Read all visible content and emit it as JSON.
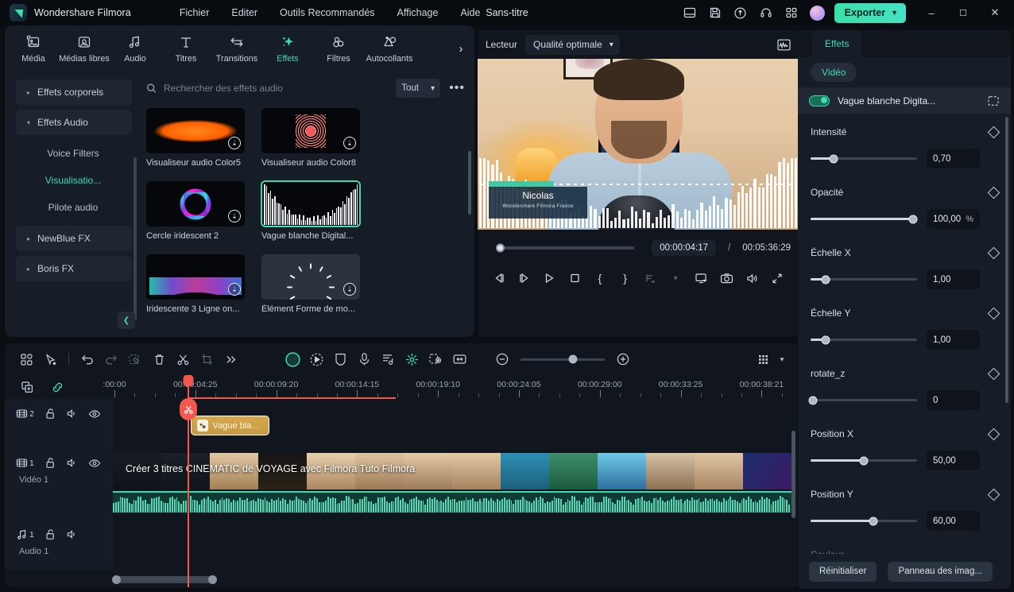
{
  "app": {
    "brand": "Wondershare Filmora",
    "document_title": "Sans-titre",
    "accent": "#3ddcb0",
    "playhead_color": "#f2584f"
  },
  "menubar": {
    "items": [
      {
        "label": "Fichier"
      },
      {
        "label": "Editer"
      },
      {
        "label": "Outils Recommandés"
      },
      {
        "label": "Affichage"
      },
      {
        "label": "Aide"
      }
    ]
  },
  "titlebar": {
    "icons": [
      {
        "name": "layout-icon"
      },
      {
        "name": "save-icon"
      },
      {
        "name": "cloud-upload-icon"
      },
      {
        "name": "headset-support-icon"
      },
      {
        "name": "apps-grid-icon"
      }
    ],
    "avatar": "user-avatar",
    "export_label": "Exporter",
    "window_buttons": {
      "minimize": "–",
      "maximize": "☐",
      "close": "✕"
    }
  },
  "ribbon": {
    "tabs": [
      {
        "label": "Média",
        "icon": "media-icon",
        "active": false
      },
      {
        "label": "Médias libres",
        "icon": "stock-media-icon",
        "active": false
      },
      {
        "label": "Audio",
        "icon": "audio-note-icon",
        "active": false
      },
      {
        "label": "Titres",
        "icon": "titles-icon",
        "active": false
      },
      {
        "label": "Transitions",
        "icon": "transitions-icon",
        "active": false
      },
      {
        "label": "Effets",
        "icon": "effects-sparkle-icon",
        "active": true
      },
      {
        "label": "Filtres",
        "icon": "filters-circles-icon",
        "active": false
      },
      {
        "label": "Autocollants",
        "icon": "stickers-icon",
        "active": false
      }
    ],
    "more": "›"
  },
  "browser": {
    "categories": [
      {
        "label": "Effets corporels",
        "type": "group",
        "expanded": false,
        "arrow": "▸"
      },
      {
        "label": "Effets Audio",
        "type": "group",
        "expanded": true,
        "arrow": "▾"
      },
      {
        "label": "Voice Filters",
        "type": "sub",
        "selected": false
      },
      {
        "label": "Visualisatio...",
        "type": "sub",
        "selected": true
      },
      {
        "label": "Pilote audio",
        "type": "sub",
        "selected": false
      },
      {
        "label": "NewBlue FX",
        "type": "group",
        "expanded": false,
        "arrow": "▸"
      },
      {
        "label": "Boris FX",
        "type": "group",
        "expanded": false,
        "arrow": "▸"
      }
    ],
    "collapse_icon": "chevron-left-icon",
    "search": {
      "placeholder": "Rechercher des effets audio",
      "value": "",
      "icon": "search-icon"
    },
    "filter": {
      "label": "Tout",
      "chevron": "⌄"
    },
    "more_options": "•••",
    "effects": [
      {
        "name": "Visualiseur audio Color5",
        "art": "lens",
        "downloadable": true,
        "selected": false
      },
      {
        "name": "Visualiseur audio Color8",
        "art": "rose",
        "downloadable": true,
        "selected": false
      },
      {
        "name": "Cercle iridescent 2",
        "art": "circle",
        "downloadable": true,
        "selected": false
      },
      {
        "name": "Vague blanche Digital...",
        "art": "bars",
        "downloadable": false,
        "selected": true
      },
      {
        "name": "Iridescente 3 Ligne on...",
        "art": "line",
        "downloadable": true,
        "selected": false
      },
      {
        "name": "Élément Forme de mo...",
        "art": "spin",
        "downloadable": true,
        "selected": false
      }
    ]
  },
  "player": {
    "title": "Lecteur",
    "quality": {
      "label": "Qualité optimale",
      "chevron": "⌄"
    },
    "scope_icon": "waveform-scope-icon",
    "preview": {
      "overlay_name": "Nicolas",
      "overlay_subtitle": "Wondershare Filmora France"
    },
    "seek_position_percent": 1.3,
    "current_time": "00:00:04:17",
    "separator": "/",
    "total_time": "00:05:36:29",
    "transport": [
      {
        "name": "previous-frame-button",
        "glyph": "◁|"
      },
      {
        "name": "next-frame-button",
        "glyph": "|▷"
      },
      {
        "name": "play-button",
        "glyph": "▷"
      },
      {
        "name": "stop-button",
        "glyph": "□"
      },
      {
        "name": "mark-in-button",
        "glyph": "{"
      },
      {
        "name": "mark-out-button",
        "glyph": "}"
      },
      {
        "name": "add-marker-button",
        "glyph": "↵",
        "disabled": true
      },
      {
        "name": "marker-dropdown-button",
        "glyph": "⌄",
        "disabled": true
      }
    ],
    "transport_right": [
      {
        "name": "display-settings-button",
        "glyph": "□"
      },
      {
        "name": "snapshot-button",
        "glyph": "◎"
      },
      {
        "name": "volume-button",
        "glyph": "◁)"
      },
      {
        "name": "fullscreen-button",
        "glyph": "⤡"
      }
    ]
  },
  "properties": {
    "tab": "Effets",
    "chip": "Vidéo",
    "effect": {
      "enabled": true,
      "name": "Vague blanche Digita...",
      "mask_icon": "mask-dotted-icon"
    },
    "rows": [
      {
        "label": "Intensité",
        "value": "0,70",
        "unit": "",
        "fill_percent": 22
      },
      {
        "label": "Opacité",
        "value": "100,00",
        "unit": "%",
        "fill_percent": 96
      },
      {
        "label": "Échelle X",
        "value": "1,00",
        "unit": "",
        "fill_percent": 14
      },
      {
        "label": "Échelle Y",
        "value": "1,00",
        "unit": "",
        "fill_percent": 14
      },
      {
        "label": "rotate_z",
        "value": "0",
        "unit": "",
        "fill_percent": 2
      },
      {
        "label": "Position X",
        "value": "50,00",
        "unit": "",
        "fill_percent": 50
      },
      {
        "label": "Position Y",
        "value": "60,00",
        "unit": "",
        "fill_percent": 59
      }
    ],
    "partial_row_label": "Couleur",
    "footer": {
      "reset": "Réinitialiser",
      "keyframe_panel": "Panneau des imag..."
    }
  },
  "timeline_toolbar": {
    "left_icons": [
      {
        "name": "template-grid-icon",
        "dim": false
      },
      {
        "name": "select-tool-icon",
        "dim": false
      }
    ],
    "edit_icons": [
      {
        "name": "undo-icon",
        "dim": false
      },
      {
        "name": "redo-icon",
        "dim": true
      },
      {
        "name": "copy-effects-icon",
        "dim": true
      },
      {
        "name": "delete-icon",
        "dim": false
      },
      {
        "name": "split-scissors-icon",
        "dim": false
      },
      {
        "name": "crop-icon",
        "dim": true
      },
      {
        "name": "more-chevrons-icon",
        "dim": false
      }
    ],
    "center_icons": [
      {
        "name": "ai-mask-icon",
        "dim": false,
        "green": true
      },
      {
        "name": "motion-tracking-icon",
        "dim": false
      },
      {
        "name": "color-match-icon",
        "dim": false
      },
      {
        "name": "record-voiceover-icon",
        "dim": false
      },
      {
        "name": "audio-beat-icon",
        "dim": false
      },
      {
        "name": "keyframe-green-icon",
        "dim": false,
        "green": true
      },
      {
        "name": "green-screen-icon",
        "dim": false
      },
      {
        "name": "adjust-duration-icon",
        "dim": false
      }
    ],
    "zoom": {
      "out_icon": "zoom-out-icon",
      "in_icon": "zoom-in-icon",
      "level_percent": 62
    },
    "right_icons": [
      {
        "name": "timeline-view-grid-icon"
      },
      {
        "name": "timeline-view-dropdown-icon"
      }
    ]
  },
  "timeline": {
    "head_icons": [
      {
        "name": "add-track-icon"
      },
      {
        "name": "link-chain-icon"
      }
    ],
    "ruler_labels": [
      ":00:00",
      "00:00:04:25",
      "00:00:09:20",
      "00:00:14:15",
      "00:00:19:10",
      "00:00:24:05",
      "00:00:29:00",
      "00:00:33:25",
      "00:00:38:21"
    ],
    "playhead_time": "00:00:04:25",
    "tracks": [
      {
        "kind": "video",
        "number": "2",
        "name": "",
        "icons": [
          "film-icon",
          "unlock-icon",
          "speaker-icon",
          "eye-icon"
        ],
        "clip": {
          "type": "effect",
          "label": "Vague blanc...",
          "icon": "effect-badge-icon"
        }
      },
      {
        "kind": "video",
        "number": "1",
        "name": "Vidéo 1",
        "icons": [
          "film-icon",
          "unlock-icon",
          "speaker-icon",
          "eye-icon"
        ],
        "clip": {
          "type": "video",
          "label": "Créer 3 titres CINEMATIC de VOYAGE avec Filmora  Tuto Filmora"
        }
      },
      {
        "kind": "audio",
        "number": "1",
        "name": "Audio 1",
        "icons": [
          "music-note-icon",
          "unlock-icon",
          "speaker-icon"
        ],
        "clip": null
      }
    ],
    "split_handle_icon": "scissors-icon"
  }
}
